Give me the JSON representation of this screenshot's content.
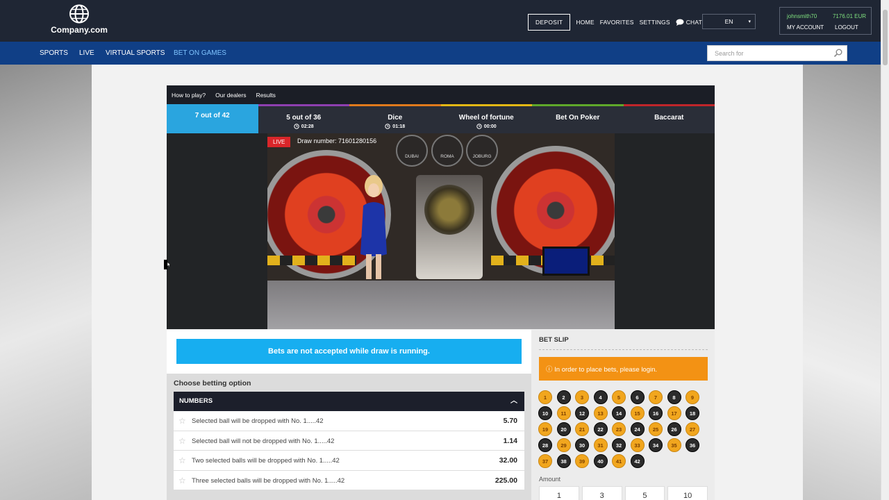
{
  "brand": {
    "name": "Company.com"
  },
  "topnav": {
    "deposit": "DEPOSIT",
    "home": "HOME",
    "favorites": "FAVORITES",
    "settings": "SETTINGS",
    "chat": "CHAT",
    "language": "EN"
  },
  "account": {
    "username": "johnsmith70",
    "balance": "7176.01 EUR",
    "my_account": "MY ACCOUNT",
    "logout": "LOGOUT"
  },
  "mainnav": {
    "items": [
      {
        "label": "SPORTS"
      },
      {
        "label": "LIVE"
      },
      {
        "label": "VIRTUAL SPORTS"
      },
      {
        "label": "BET ON GAMES"
      }
    ]
  },
  "search": {
    "placeholder": "Search for"
  },
  "subnav": {
    "how_to_play": "How to play?",
    "our_dealers": "Our dealers",
    "results": "Results"
  },
  "game_tabs": [
    {
      "label": "7 out of 42",
      "time": "",
      "color": "#2aa5df"
    },
    {
      "label": "5 out of 36",
      "time": "02:28",
      "color": "#8e3fb0"
    },
    {
      "label": "Dice",
      "time": "01:18",
      "color": "#e07a1c"
    },
    {
      "label": "Wheel of fortune",
      "time": "00:00",
      "color": "#e3b814"
    },
    {
      "label": "Bet On Poker",
      "time": "",
      "color": "#5fa82a"
    },
    {
      "label": "Baccarat",
      "time": "",
      "color": "#c0252a"
    }
  ],
  "video": {
    "live": "LIVE",
    "draw_number": "Draw number: 71601280156",
    "clocks": [
      "DUBAI",
      "ROMA",
      "JOBURG"
    ]
  },
  "notice": "Bets are not accepted while draw is running.",
  "betting": {
    "title": "Choose betting option",
    "group": "NUMBERS",
    "options": [
      {
        "text": "Selected ball will be dropped with No. 1.....42",
        "odds": "5.70"
      },
      {
        "text": "Selected ball will not be dropped with No. 1.....42",
        "odds": "1.14"
      },
      {
        "text": "Two selected balls will be dropped with No. 1.....42",
        "odds": "32.00"
      },
      {
        "text": "Three selected balls will be dropped with No. 1.....42",
        "odds": "225.00"
      }
    ]
  },
  "betslip": {
    "title": "BET SLIP",
    "login_warning": "In order to place bets, please login.",
    "balls": [
      "1",
      "2",
      "3",
      "4",
      "5",
      "6",
      "7",
      "8",
      "9",
      "10",
      "11",
      "12",
      "13",
      "14",
      "15",
      "16",
      "17",
      "18",
      "19",
      "20",
      "21",
      "22",
      "23",
      "24",
      "25",
      "26",
      "27",
      "28",
      "29",
      "30",
      "31",
      "32",
      "33",
      "34",
      "35",
      "36",
      "37",
      "38",
      "39",
      "40",
      "41",
      "42"
    ],
    "amount_label": "Amount",
    "amounts": [
      "1",
      "3",
      "5",
      "10"
    ]
  }
}
